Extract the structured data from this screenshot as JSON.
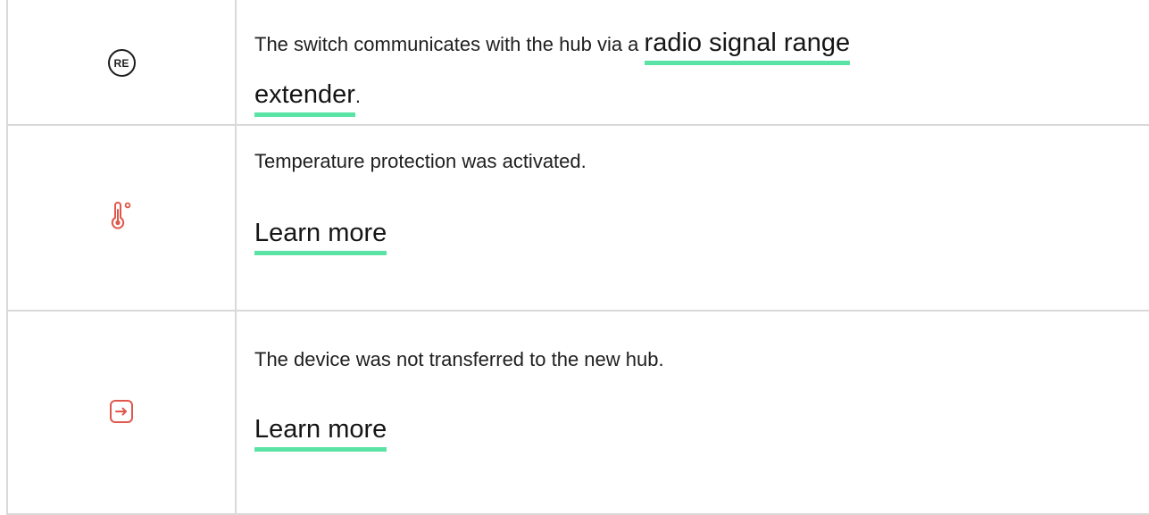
{
  "rows": [
    {
      "icon": "re-icon",
      "icon_text": "RE",
      "text_before_link": "The switch communicates with the hub via a ",
      "link_part1": "radio signal range",
      "link_part2": "extender",
      "text_after_link": "."
    },
    {
      "icon": "thermometer-icon",
      "text": "Temperature protection was activated.",
      "link": "Learn more"
    },
    {
      "icon": "arrow-right-box-icon",
      "text": "The device was not transferred to the new hub.",
      "link": "Learn more"
    }
  ],
  "colors": {
    "link_underline": "#5be3a6",
    "warning_icon": "#e0574b",
    "border": "#d9d9d9",
    "text": "#1f1f1f"
  }
}
